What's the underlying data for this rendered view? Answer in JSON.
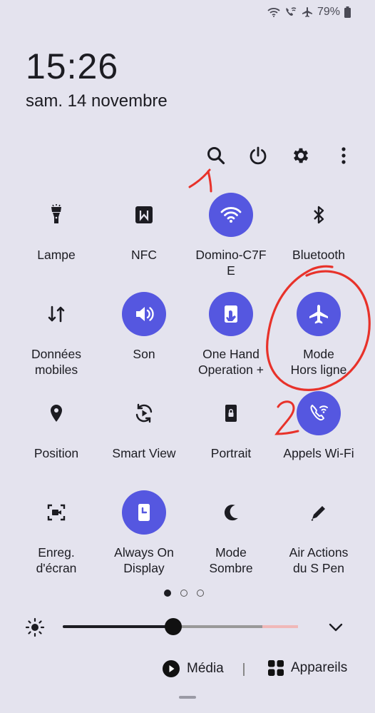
{
  "status_bar": {
    "battery": "79%",
    "icons": [
      "wifi-icon",
      "wifi-calling-icon",
      "airplane-icon",
      "battery-icon"
    ]
  },
  "lockscreen": {
    "time": "15:26",
    "date": "sam. 14 novembre"
  },
  "top_actions": [
    "search-icon",
    "power-icon",
    "gear-icon",
    "more-vert-icon"
  ],
  "tiles": [
    {
      "label": "Lampe",
      "icon": "flashlight-icon",
      "on": false
    },
    {
      "label": "NFC",
      "icon": "nfc-icon",
      "on": false
    },
    {
      "label": "Domino-C7F\nE",
      "icon": "wifi-icon",
      "on": true
    },
    {
      "label": "Bluetooth",
      "icon": "bluetooth-icon",
      "on": false
    },
    {
      "label": "Données\nmobiles",
      "icon": "mobile-data-icon",
      "on": false
    },
    {
      "label": "Son",
      "icon": "sound-icon",
      "on": true
    },
    {
      "label": "One Hand\nOperation +",
      "icon": "one-hand-icon",
      "on": true
    },
    {
      "label": "Mode\nHors ligne",
      "icon": "airplane-icon",
      "on": true
    },
    {
      "label": "Position",
      "icon": "location-icon",
      "on": false
    },
    {
      "label": "Smart View",
      "icon": "smart-view-icon",
      "on": false
    },
    {
      "label": "Portrait",
      "icon": "portrait-lock-icon",
      "on": false
    },
    {
      "label": "Appels Wi-Fi",
      "icon": "wifi-calling-icon",
      "on": true
    },
    {
      "label": "Enreg.\nd'écran",
      "icon": "screen-record-icon",
      "on": false
    },
    {
      "label": "Always On\nDisplay",
      "icon": "always-on-display-icon",
      "on": true
    },
    {
      "label": "Mode\nSombre",
      "icon": "moon-icon",
      "on": false
    },
    {
      "label": "Air Actions\ndu S Pen",
      "icon": "pen-icon",
      "on": false
    }
  ],
  "pager": {
    "pages": 3,
    "current": 1
  },
  "brightness": {
    "level": 0.47,
    "icon": "brightness-icon"
  },
  "bottom": {
    "media_label": "Média",
    "devices_label": "Appareils"
  },
  "annotations": {
    "mark_1": "1",
    "mark_2": "2"
  },
  "colors": {
    "accent": "#5557e0",
    "background": "#e4e3ee",
    "annotation": "#e8322a"
  }
}
